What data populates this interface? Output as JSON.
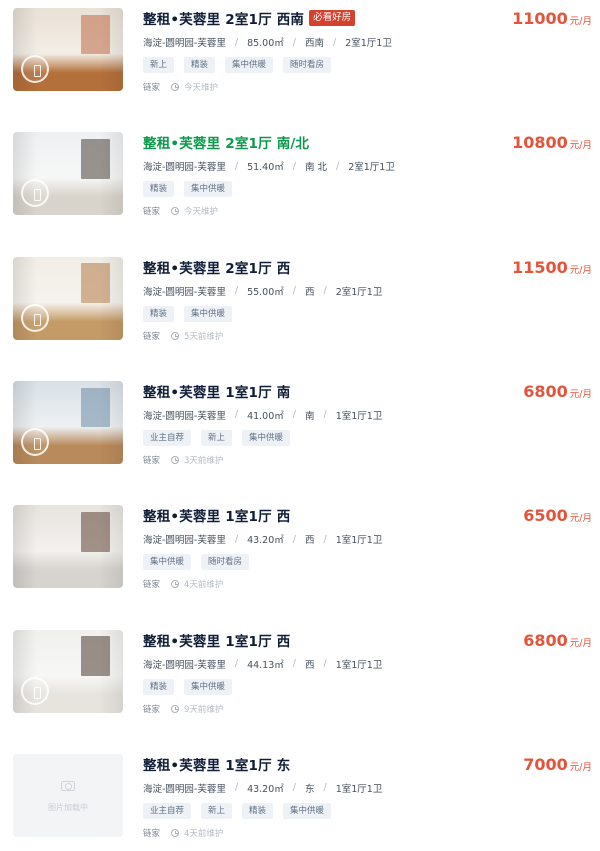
{
  "listings": [
    {
      "title": "整租•芙蓉里 2室1厅 西南",
      "badge": "必看好房",
      "price": "11000",
      "price_unit": "元/月",
      "district": "海淀-圆明园-芙蓉里",
      "area": "85.00㎡",
      "orientation": "西南",
      "layout": "2室1厅1卫",
      "tags": [
        "新上",
        "精装",
        "集中供暖",
        "随时看房"
      ],
      "brand": "链家",
      "maintained": "今天维护",
      "visited": false,
      "has_vr": true,
      "photo_icon": "room-photo",
      "photo_palette": {
        "top": "#e9e1d6",
        "mid": "#f2ede6",
        "floor": "#b4703b",
        "accent": "#c06a45"
      }
    },
    {
      "title": "整租•芙蓉里 2室1厅 南/北",
      "badge": "",
      "price": "10800",
      "price_unit": "元/月",
      "district": "海淀-圆明园-芙蓉里",
      "area": "51.40㎡",
      "orientation": "南 北",
      "layout": "2室1厅1卫",
      "tags": [
        "精装",
        "集中供暖"
      ],
      "brand": "链家",
      "maintained": "今天维护",
      "visited": true,
      "has_vr": true,
      "photo_icon": "room-photo",
      "photo_palette": {
        "top": "#eef0f2",
        "mid": "#f7f7f7",
        "floor": "#d9d4cb",
        "accent": "#4a3f38"
      }
    },
    {
      "title": "整租•芙蓉里 2室1厅 西",
      "badge": "",
      "price": "11500",
      "price_unit": "元/月",
      "district": "海淀-圆明园-芙蓉里",
      "area": "55.00㎡",
      "orientation": "西",
      "layout": "2室1厅1卫",
      "tags": [
        "精装",
        "集中供暖"
      ],
      "brand": "链家",
      "maintained": "5天前维护",
      "visited": false,
      "has_vr": true,
      "photo_icon": "room-photo",
      "photo_palette": {
        "top": "#f1ede6",
        "mid": "#f6f3ee",
        "floor": "#c49a66",
        "accent": "#b07a45"
      }
    },
    {
      "title": "整租•芙蓉里 1室1厅 南",
      "badge": "",
      "price": "6800",
      "price_unit": "元/月",
      "district": "海淀-圆明园-芙蓉里",
      "area": "41.00㎡",
      "orientation": "南",
      "layout": "1室1厅1卫",
      "tags": [
        "业主自荐",
        "新上",
        "集中供暖"
      ],
      "brand": "链家",
      "maintained": "3天前维护",
      "visited": false,
      "has_vr": true,
      "photo_icon": "room-photo",
      "photo_palette": {
        "top": "#d8e0e6",
        "mid": "#eef1f3",
        "floor": "#b98a5b",
        "accent": "#6c8aa5"
      }
    },
    {
      "title": "整租•芙蓉里 1室1厅 西",
      "badge": "",
      "price": "6500",
      "price_unit": "元/月",
      "district": "海淀-圆明园-芙蓉里",
      "area": "43.20㎡",
      "orientation": "西",
      "layout": "1室1厅1卫",
      "tags": [
        "集中供暖",
        "随时看房"
      ],
      "brand": "链家",
      "maintained": "4天前维护",
      "visited": false,
      "has_vr": false,
      "photo_icon": "room-photo",
      "photo_palette": {
        "top": "#e7e3de",
        "mid": "#f3f1ee",
        "floor": "#d7d3cf",
        "accent": "#5c4134"
      }
    },
    {
      "title": "整租•芙蓉里 1室1厅 西",
      "badge": "",
      "price": "6800",
      "price_unit": "元/月",
      "district": "海淀-圆明园-芙蓉里",
      "area": "44.13㎡",
      "orientation": "西",
      "layout": "1室1厅1卫",
      "tags": [
        "精装",
        "集中供暖"
      ],
      "brand": "链家",
      "maintained": "9天前维护",
      "visited": false,
      "has_vr": true,
      "photo_icon": "room-photo",
      "photo_palette": {
        "top": "#f0f0ee",
        "mid": "#f7f7f5",
        "floor": "#e7e4df",
        "accent": "#4e3a2f"
      }
    },
    {
      "title": "整租•芙蓉里 1室1厅 东",
      "badge": "",
      "price": "7000",
      "price_unit": "元/月",
      "district": "海淀-圆明园-芙蓉里",
      "area": "43.20㎡",
      "orientation": "东",
      "layout": "1室1厅1卫",
      "tags": [
        "业主自荐",
        "新上",
        "精装",
        "集中供暖"
      ],
      "brand": "链家",
      "maintained": "4天前维护",
      "visited": false,
      "has_vr": false,
      "photo_icon": "camera-icon",
      "placeholder_text": "图片加载中"
    }
  ],
  "colors": {
    "title": "#101d37",
    "title_visited": "#0c9a4a",
    "price": "#e4543b",
    "badge": "#d5412f",
    "tag_bg": "#eef2f7",
    "tag_text": "#607084"
  }
}
